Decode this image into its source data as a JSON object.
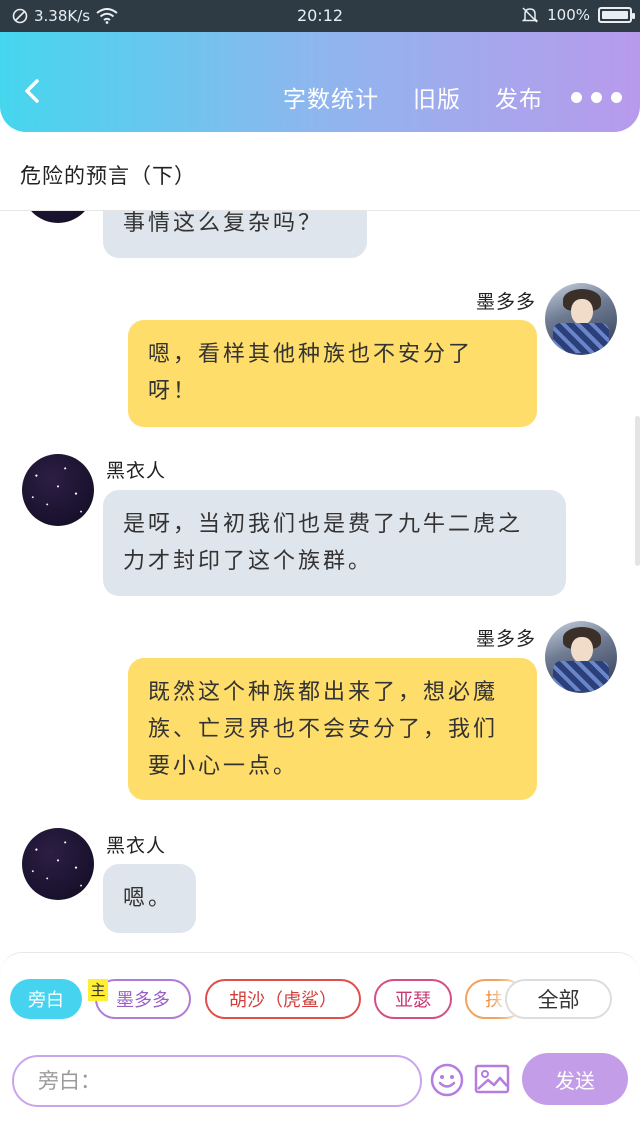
{
  "status_bar": {
    "net_speed": "3.38K/s",
    "time": "20:12",
    "battery": "100%",
    "battery_level": 1.0
  },
  "header": {
    "back_icon": "chevron-left-icon",
    "actions": [
      "字数统计",
      "旧版",
      "发布"
    ],
    "more_icon": "more-dots-icon"
  },
  "chapter": {
    "title": "危险的预言（下）"
  },
  "messages": [
    {
      "side": "left",
      "sender": "",
      "text": "事情这么复杂吗？"
    },
    {
      "side": "right",
      "sender": "墨多多",
      "text": "嗯，看样其他种族也不安分了呀！"
    },
    {
      "side": "left",
      "sender": "黑衣人",
      "text": "是呀，当初我们也是费了九牛二虎之力才封印了这个族群。"
    },
    {
      "side": "right",
      "sender": "墨多多",
      "text": "既然这个种族都出来了，想必魔族、亡灵界也不会安分了，我们要小心一点。"
    },
    {
      "side": "left",
      "sender": "黑衣人",
      "text": "嗯。"
    }
  ],
  "character_bar": {
    "chips": [
      "旁白",
      "墨多多",
      "胡沙（虎鲨）",
      "亚瑟",
      "扶",
      "全部"
    ],
    "host_badge": "主"
  },
  "composer": {
    "placeholder": "旁白：",
    "send_label": "发送",
    "emoji_icon": "smiley-icon",
    "image_icon": "image-icon"
  },
  "colors": {
    "header_gradient": [
      "#45d6ee",
      "#b89aec"
    ],
    "left_bubble": "#dfe5ec",
    "right_bubble": "#fedd6a",
    "send_button": "#c49de8"
  }
}
